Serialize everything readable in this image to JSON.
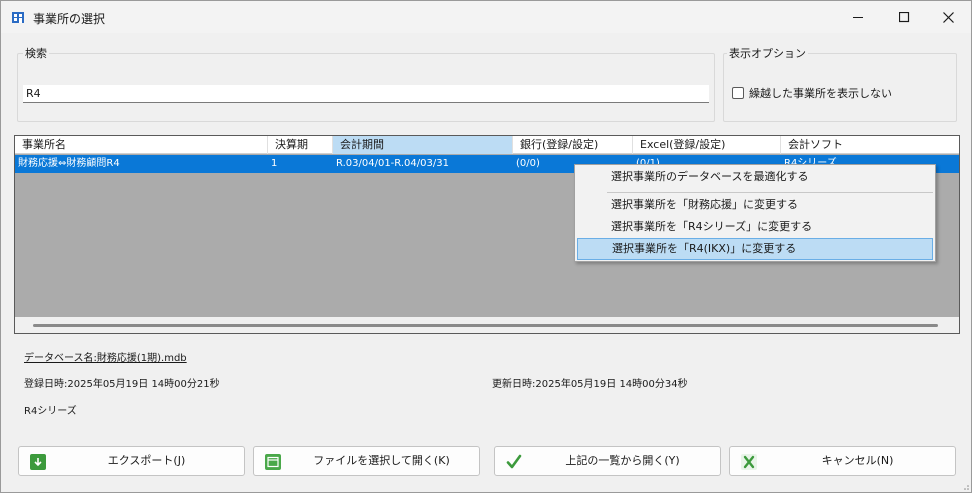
{
  "window": {
    "title": "事業所の選択"
  },
  "search": {
    "group_label": "検索",
    "value": "R4"
  },
  "options": {
    "group_label": "表示オプション",
    "hide_label": "繰越した事業所を表示しない",
    "hide_checked": false
  },
  "grid": {
    "columns": [
      "事業所名",
      "決算期",
      "会計期間",
      "銀行(登録/設定)",
      "Excel(登録/設定)",
      "会計ソフト"
    ],
    "rows": [
      [
        "財務応援⇔財務顧問R4",
        "1",
        "R.03/04/01-R.04/03/31",
        "(0/0)",
        "(0/1)",
        "R4シリーズ"
      ]
    ]
  },
  "context_menu": {
    "items": [
      "選択事業所のデータベースを最適化する",
      "選択事業所を「財務応援」に変更する",
      "選択事業所を「R4シリーズ」に変更する",
      "選択事業所を「R4(IKX)」に変更する"
    ]
  },
  "info": {
    "database": "データベース名:財務応援(1期).mdb",
    "registered": "登録日時:2025年05月19日 14時00分21秒",
    "updated": "更新日時:2025年05月19日 14時00分34秒",
    "software": "R4シリーズ"
  },
  "buttons": {
    "export": "エクスポート(J)",
    "open_file": "ファイルを選択して開く(K)",
    "open_list": "上記の一覧から開く(Y)",
    "cancel": "キャンセル(N)"
  },
  "colors": {
    "selection": "#0a78d7",
    "menu_highlight": "#bcdcf4",
    "export_icon": "#3c9a3c",
    "open_icon": "#4aa84a"
  }
}
